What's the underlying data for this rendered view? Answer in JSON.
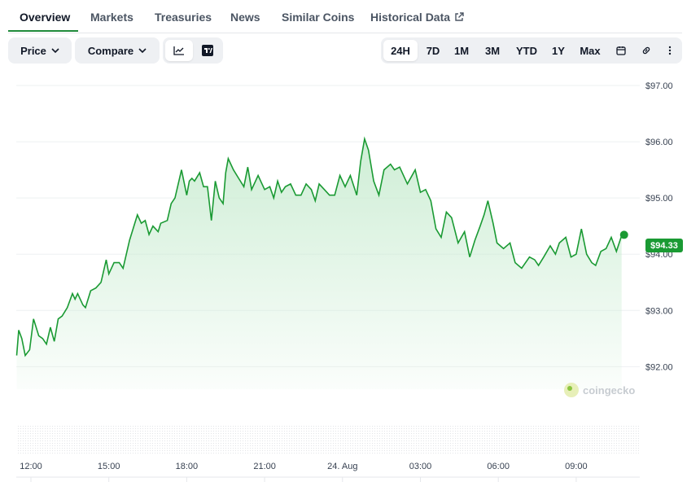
{
  "tabs": [
    {
      "label": "Overview",
      "active": true
    },
    {
      "label": "Markets"
    },
    {
      "label": "Treasuries"
    },
    {
      "label": "News"
    },
    {
      "label": "Similar Coins"
    },
    {
      "label": "Historical Data",
      "external": true
    }
  ],
  "toolbar": {
    "price_label": "Price",
    "compare_label": "Compare",
    "chart_icons": [
      "line-chart-icon",
      "tradingview-icon"
    ],
    "ranges": [
      "24H",
      "7D",
      "1M",
      "3M",
      "YTD",
      "1Y",
      "Max"
    ],
    "active_range": "24H",
    "extra_icons": [
      "calendar-icon",
      "link-icon",
      "more-icon"
    ]
  },
  "colors": {
    "line": "#1a9a33",
    "area_top": "#c9ecd1",
    "badge": "#1a9a33",
    "accent_underline": "#1f8a3a"
  },
  "watermark": "coingecko",
  "current_price_label": "$94.33",
  "chart_data": {
    "type": "area",
    "title": "",
    "xlabel": "",
    "ylabel": "",
    "ylim": [
      91.6,
      97.0
    ],
    "yticks": [
      "$97.00",
      "$96.00",
      "$95.00",
      "$94.00",
      "$93.00",
      "$92.00"
    ],
    "ytick_values": [
      97,
      96,
      95,
      94,
      93,
      92
    ],
    "xticks": [
      "12:00",
      "15:00",
      "18:00",
      "21:00",
      "24. Aug",
      "03:00",
      "06:00",
      "09:00"
    ],
    "xtick_hours": [
      0,
      3,
      6,
      9,
      12,
      15,
      18,
      21
    ],
    "x_hours": [
      -0.55,
      -0.47,
      -0.35,
      -0.22,
      -0.05,
      0.1,
      0.3,
      0.45,
      0.6,
      0.75,
      0.9,
      1.05,
      1.2,
      1.4,
      1.6,
      1.7,
      1.8,
      2.0,
      2.1,
      2.3,
      2.5,
      2.7,
      2.9,
      3.0,
      3.2,
      3.4,
      3.55,
      3.8,
      4.1,
      4.25,
      4.4,
      4.55,
      4.7,
      4.9,
      5.0,
      5.25,
      5.4,
      5.55,
      5.8,
      6.0,
      6.1,
      6.2,
      6.3,
      6.5,
      6.65,
      6.8,
      6.95,
      7.1,
      7.25,
      7.4,
      7.5,
      7.6,
      7.8,
      8.0,
      8.2,
      8.35,
      8.5,
      8.75,
      9.0,
      9.2,
      9.35,
      9.5,
      9.65,
      9.8,
      10.0,
      10.2,
      10.4,
      10.6,
      10.8,
      10.95,
      11.1,
      11.3,
      11.5,
      11.7,
      11.9,
      12.1,
      12.3,
      12.55,
      12.7,
      12.85,
      13.0,
      13.2,
      13.4,
      13.6,
      13.85,
      14.0,
      14.2,
      14.5,
      14.8,
      15.0,
      15.2,
      15.4,
      15.6,
      15.8,
      16.0,
      16.2,
      16.45,
      16.7,
      16.9,
      17.1,
      17.3,
      17.45,
      17.6,
      17.8,
      17.95,
      18.2,
      18.45,
      18.65,
      18.9,
      19.2,
      19.4,
      19.55,
      19.75,
      20.0,
      20.2,
      20.35,
      20.6,
      20.8,
      21.0,
      21.2,
      21.4,
      21.6,
      21.75,
      21.95,
      22.15,
      22.35,
      22.55,
      22.75
    ],
    "series": [
      {
        "values": [
          92.2,
          92.65,
          92.5,
          92.2,
          92.3,
          92.85,
          92.55,
          92.5,
          92.4,
          92.7,
          92.45,
          92.85,
          92.9,
          93.05,
          93.3,
          93.2,
          93.3,
          93.1,
          93.05,
          93.35,
          93.4,
          93.5,
          93.9,
          93.65,
          93.85,
          93.85,
          93.75,
          94.25,
          94.7,
          94.55,
          94.6,
          94.35,
          94.5,
          94.4,
          94.55,
          94.6,
          94.9,
          95.0,
          95.5,
          95.05,
          95.3,
          95.35,
          95.3,
          95.45,
          95.2,
          95.2,
          94.6,
          95.3,
          95.0,
          94.9,
          95.45,
          95.7,
          95.5,
          95.35,
          95.2,
          95.55,
          95.15,
          95.4,
          95.15,
          95.2,
          95.0,
          95.3,
          95.1,
          95.2,
          95.25,
          95.05,
          95.05,
          95.25,
          95.15,
          94.95,
          95.25,
          95.15,
          95.05,
          95.05,
          95.4,
          95.2,
          95.4,
          95.05,
          95.65,
          96.05,
          95.85,
          95.3,
          95.05,
          95.5,
          95.6,
          95.5,
          95.55,
          95.25,
          95.5,
          95.1,
          95.15,
          94.95,
          94.45,
          94.3,
          94.75,
          94.65,
          94.2,
          94.4,
          93.95,
          94.25,
          94.5,
          94.7,
          94.95,
          94.55,
          94.2,
          94.1,
          94.2,
          93.85,
          93.75,
          93.95,
          93.9,
          93.8,
          93.95,
          94.15,
          94.0,
          94.2,
          94.3,
          93.95,
          94.0,
          94.45,
          94.0,
          93.85,
          93.8,
          94.05,
          94.1,
          94.3,
          94.05,
          94.33
        ]
      }
    ],
    "legend": "none",
    "grid": true
  }
}
